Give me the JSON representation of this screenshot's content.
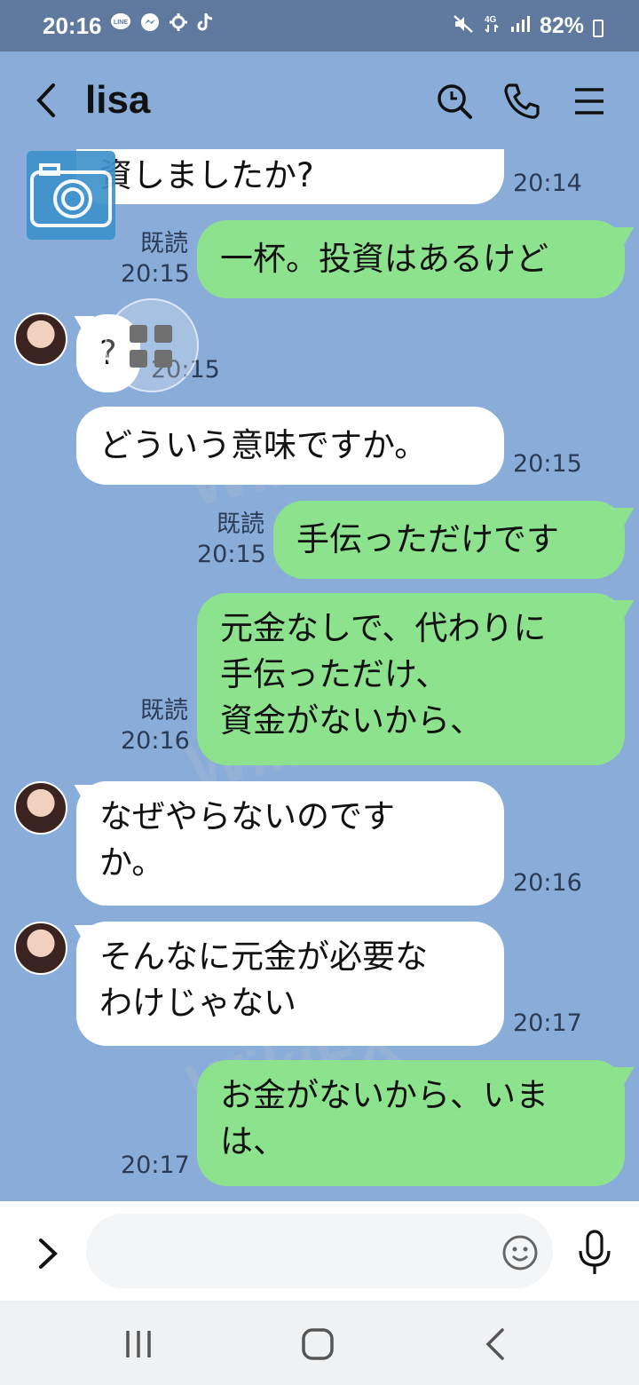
{
  "status_bar": {
    "time": "20:16",
    "battery": "82%",
    "left_icons": [
      "line-icon",
      "messenger-icon",
      "settings-icon",
      "tiktok-icon"
    ],
    "right_icons": [
      "mute-icon",
      "4g-icon",
      "signal-icon",
      "battery-icon"
    ]
  },
  "header": {
    "title": "lisa",
    "icons": [
      "back-icon",
      "search-icon",
      "phone-icon",
      "menu-icon"
    ]
  },
  "messages": [
    {
      "side": "in",
      "text": "資しましたか?",
      "time": "20:14"
    },
    {
      "side": "out",
      "read": "既読",
      "text": "一杯。投資はあるけど",
      "time": "20:15"
    },
    {
      "side": "in",
      "text": "?",
      "time": "20:15"
    },
    {
      "side": "in",
      "text": "どういう意味ですか。",
      "time": "20:15"
    },
    {
      "side": "out",
      "read": "既読",
      "text": "手伝っただけです",
      "time": "20:15"
    },
    {
      "side": "out",
      "read": "既読",
      "text": "元金なしで、代わりに\n手伝っただけ、\n資金がないから、",
      "time": "20:16"
    },
    {
      "side": "in",
      "text": "なぜやらないのです\nか。",
      "time": "20:16"
    },
    {
      "side": "in",
      "text": "そんなに元金が必要な\nわけじゃない",
      "time": "20:17"
    },
    {
      "side": "out",
      "read": "",
      "text": "お金がないから、いま\nは、",
      "time": "20:17"
    }
  ],
  "watermark": "WikiFX",
  "input": {
    "placeholder": ""
  },
  "colors": {
    "chat_background": "#8aacd9",
    "outgoing_bubble": "#8de28d",
    "incoming_bubble": "#ffffff",
    "status_bar": "#5f7a9e"
  }
}
